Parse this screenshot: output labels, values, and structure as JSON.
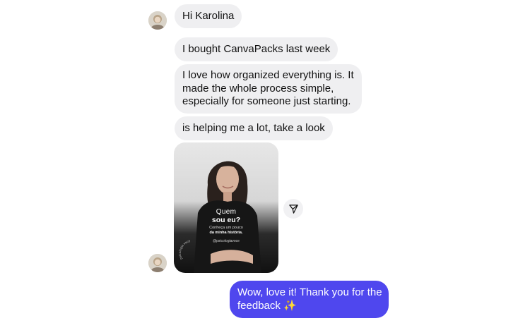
{
  "conversation": {
    "messages": [
      {
        "sender": "other",
        "text": "Hi Karolina"
      },
      {
        "sender": "other",
        "text": "I bought CanvaPacks last week"
      },
      {
        "sender": "other",
        "lines": [
          "I love how organized everything is. It",
          "made the whole process simple,",
          "especially for someone just starting."
        ]
      },
      {
        "sender": "other",
        "text": "is helping me a lot, take a look"
      },
      {
        "sender": "self",
        "lines": [
          "Wow, love it! Thank you for the",
          "feedback ✨"
        ]
      }
    ],
    "shared_post": {
      "title_line1": "Quem",
      "title_line2": "sou eu?",
      "subtitle_line1": "Conheça um pouco",
      "subtitle_line2": "da minha história.",
      "handle": "@psicologiavoce",
      "arc_text": "psicologia você"
    }
  },
  "colors": {
    "incoming_bubble": "#efeff1",
    "outgoing_bubble": "#4f47ee",
    "outgoing_text": "#ffffff"
  },
  "icons": {
    "share": "paper-plane-icon",
    "avatar": "user-avatar"
  }
}
